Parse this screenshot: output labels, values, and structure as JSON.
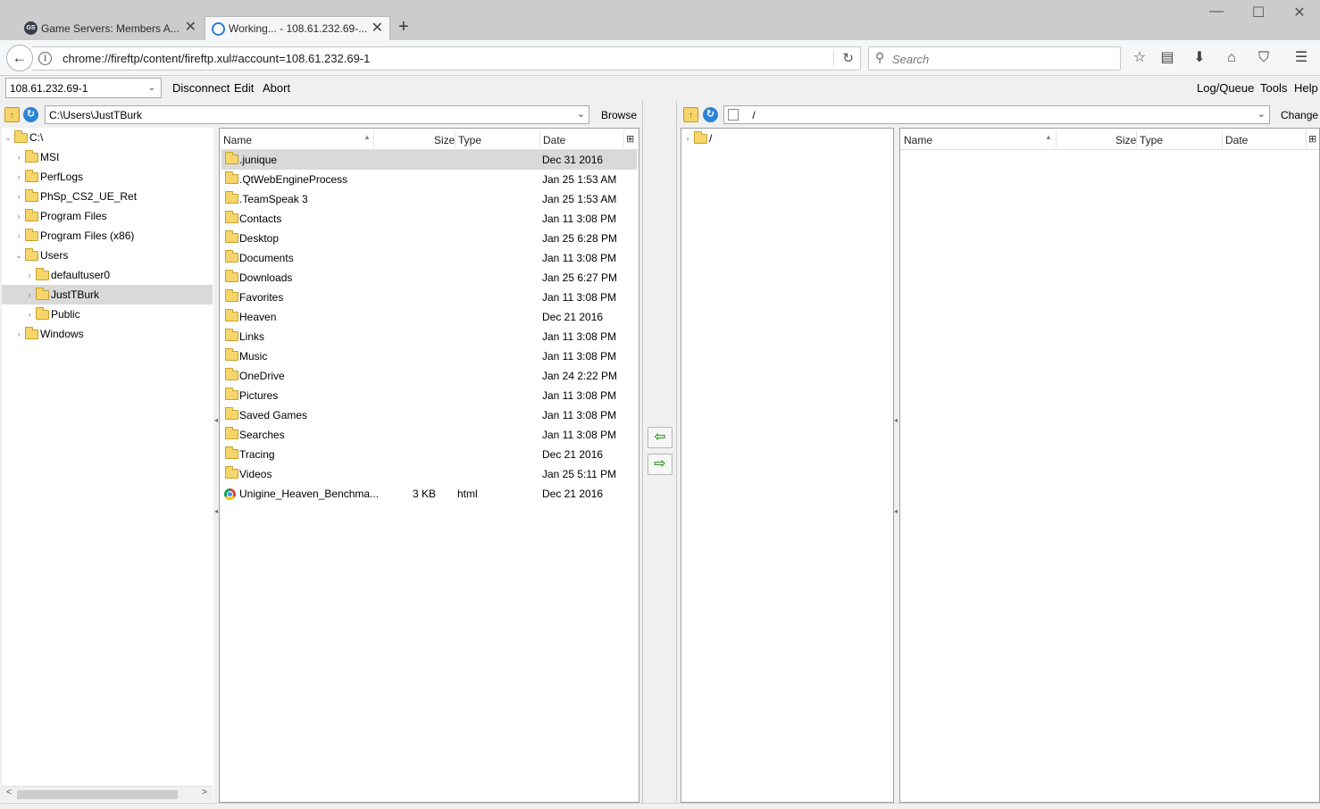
{
  "browser": {
    "tabs": [
      {
        "title": "Game Servers: Members A...",
        "active": false
      },
      {
        "title": "Working... - 108.61.232.69-...",
        "active": true
      }
    ],
    "url": "chrome://fireftp/content/fireftp.xul#account=108.61.232.69-1",
    "search_placeholder": "Search"
  },
  "toolbar": {
    "account": "108.61.232.69-1",
    "menu_left": [
      "Disconnect",
      "Edit",
      "Abort"
    ],
    "menu_right": [
      "Log/Queue",
      "Tools",
      "Help"
    ]
  },
  "local": {
    "path": "C:\\Users\\JustTBurk",
    "browse_label": "Browse",
    "tree": [
      {
        "label": "C:\\",
        "level": 0,
        "expanded": true,
        "selected": false
      },
      {
        "label": "MSI",
        "level": 1,
        "expanded": false,
        "selected": false
      },
      {
        "label": "PerfLogs",
        "level": 1,
        "expanded": false,
        "selected": false
      },
      {
        "label": "PhSp_CS2_UE_Ret",
        "level": 1,
        "expanded": false,
        "selected": false
      },
      {
        "label": "Program Files",
        "level": 1,
        "expanded": false,
        "selected": false
      },
      {
        "label": "Program Files (x86)",
        "level": 1,
        "expanded": false,
        "selected": false
      },
      {
        "label": "Users",
        "level": 1,
        "expanded": true,
        "selected": false
      },
      {
        "label": "defaultuser0",
        "level": 2,
        "expanded": false,
        "selected": false
      },
      {
        "label": "JustTBurk",
        "level": 2,
        "expanded": false,
        "selected": true
      },
      {
        "label": "Public",
        "level": 2,
        "expanded": false,
        "selected": false
      },
      {
        "label": "Windows",
        "level": 1,
        "expanded": false,
        "selected": false
      }
    ],
    "columns": {
      "name": "Name",
      "size": "Size",
      "type": "Type",
      "date": "Date"
    },
    "files": [
      {
        "name": ".junique",
        "size": "",
        "type": "",
        "date": "Dec 31 2016",
        "kind": "folder",
        "selected": true
      },
      {
        "name": ".QtWebEngineProcess",
        "size": "",
        "type": "",
        "date": "Jan 25 1:53 AM",
        "kind": "folder",
        "selected": false
      },
      {
        "name": ".TeamSpeak 3",
        "size": "",
        "type": "",
        "date": "Jan 25 1:53 AM",
        "kind": "folder",
        "selected": false
      },
      {
        "name": "Contacts",
        "size": "",
        "type": "",
        "date": "Jan 11 3:08 PM",
        "kind": "folder",
        "selected": false
      },
      {
        "name": "Desktop",
        "size": "",
        "type": "",
        "date": "Jan 25 6:28 PM",
        "kind": "folder",
        "selected": false
      },
      {
        "name": "Documents",
        "size": "",
        "type": "",
        "date": "Jan 11 3:08 PM",
        "kind": "folder",
        "selected": false
      },
      {
        "name": "Downloads",
        "size": "",
        "type": "",
        "date": "Jan 25 6:27 PM",
        "kind": "folder",
        "selected": false
      },
      {
        "name": "Favorites",
        "size": "",
        "type": "",
        "date": "Jan 11 3:08 PM",
        "kind": "folder",
        "selected": false
      },
      {
        "name": "Heaven",
        "size": "",
        "type": "",
        "date": "Dec 21 2016",
        "kind": "folder",
        "selected": false
      },
      {
        "name": "Links",
        "size": "",
        "type": "",
        "date": "Jan 11 3:08 PM",
        "kind": "folder",
        "selected": false
      },
      {
        "name": "Music",
        "size": "",
        "type": "",
        "date": "Jan 11 3:08 PM",
        "kind": "folder",
        "selected": false
      },
      {
        "name": "OneDrive",
        "size": "",
        "type": "",
        "date": "Jan 24 2:22 PM",
        "kind": "folder",
        "selected": false
      },
      {
        "name": "Pictures",
        "size": "",
        "type": "",
        "date": "Jan 11 3:08 PM",
        "kind": "folder",
        "selected": false
      },
      {
        "name": "Saved Games",
        "size": "",
        "type": "",
        "date": "Jan 11 3:08 PM",
        "kind": "folder",
        "selected": false
      },
      {
        "name": "Searches",
        "size": "",
        "type": "",
        "date": "Jan 11 3:08 PM",
        "kind": "folder",
        "selected": false
      },
      {
        "name": "Tracing",
        "size": "",
        "type": "",
        "date": "Dec 21 2016",
        "kind": "folder",
        "selected": false
      },
      {
        "name": "Videos",
        "size": "",
        "type": "",
        "date": "Jan 25 5:11 PM",
        "kind": "folder",
        "selected": false
      },
      {
        "name": "Unigine_Heaven_Benchma...",
        "size": "3 KB",
        "type": "html",
        "date": "Dec 21 2016",
        "kind": "html",
        "selected": false
      }
    ]
  },
  "remote": {
    "path": "/",
    "change_label": "Change",
    "tree": [
      {
        "label": "/"
      }
    ],
    "columns": {
      "name": "Name",
      "size": "Size",
      "type": "Type",
      "date": "Date"
    }
  }
}
